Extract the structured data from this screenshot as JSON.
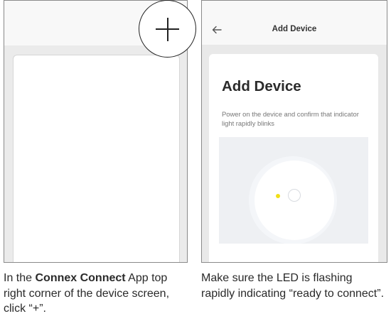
{
  "left_panel": {
    "plus_icon": "plus-icon",
    "caption_prefix": "In the ",
    "caption_bold": "Connex Connect",
    "caption_suffix": " App top right corner of the device screen, click “+”."
  },
  "right_panel": {
    "back_icon": "back-arrow-icon",
    "header_title": "Add Device",
    "card_title": "Add Device",
    "card_description": "Power on the device and confirm that indicator light rapidly blinks",
    "led_color": "#f1df16",
    "caption": "Make sure the LED is flashing rapidly indicating “ready to connect”."
  }
}
